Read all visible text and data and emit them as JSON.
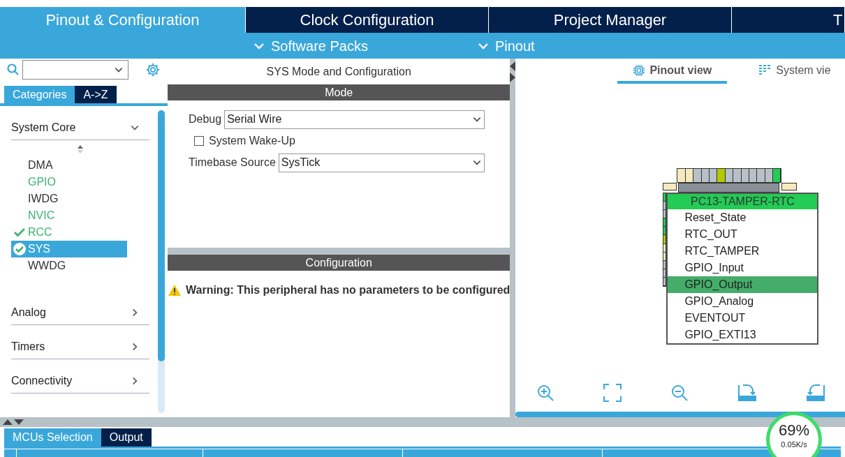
{
  "main_tabs": [
    {
      "label": "Pinout & Configuration",
      "selected": true
    },
    {
      "label": "Clock Configuration",
      "selected": false
    },
    {
      "label": "Project Manager",
      "selected": false
    },
    {
      "label": "T",
      "selected": false
    }
  ],
  "sub_menu": [
    "Software Packs",
    "Pinout"
  ],
  "sidebar": {
    "tabs": [
      {
        "label": "Categories",
        "selected": true
      },
      {
        "label": "A->Z",
        "selected": false
      }
    ],
    "categories": [
      {
        "name": "System Core",
        "expanded": true,
        "children": [
          {
            "name": "DMA",
            "enabled": false,
            "configured": false,
            "selected": false
          },
          {
            "name": "GPIO",
            "enabled": true,
            "configured": false,
            "selected": false
          },
          {
            "name": "IWDG",
            "enabled": false,
            "configured": false,
            "selected": false
          },
          {
            "name": "NVIC",
            "enabled": true,
            "configured": false,
            "selected": false
          },
          {
            "name": "RCC",
            "enabled": true,
            "configured": true,
            "selected": false
          },
          {
            "name": "SYS",
            "enabled": true,
            "configured": true,
            "selected": true
          },
          {
            "name": "WWDG",
            "enabled": false,
            "configured": false,
            "selected": false
          }
        ]
      },
      {
        "name": "Analog",
        "expanded": false
      },
      {
        "name": "Timers",
        "expanded": false
      },
      {
        "name": "Connectivity",
        "expanded": false
      }
    ]
  },
  "config_panel": {
    "title": "SYS Mode and Configuration",
    "mode_header": "Mode",
    "fields": [
      {
        "kind": "select",
        "label": "Debug",
        "value": "Serial Wire"
      },
      {
        "kind": "checkbox",
        "label": "System Wake-Up",
        "checked": false
      },
      {
        "kind": "select",
        "label": "Timebase Source",
        "value": "SysTick"
      }
    ],
    "configuration_header": "Configuration",
    "warning": "**Warning:** **This peripheral has no parameters to be configured**"
  },
  "view_tabs": [
    {
      "label": "Pinout view",
      "selected": true
    },
    {
      "label": "System vie",
      "selected": false
    }
  ],
  "pin_menu": {
    "title": "PC13-TAMPER-RTC",
    "options": [
      {
        "label": "Reset_State",
        "selected": false
      },
      {
        "label": "RTC_OUT",
        "selected": false
      },
      {
        "label": "RTC_TAMPER",
        "selected": false
      },
      {
        "label": "GPIO_Input",
        "selected": false
      },
      {
        "label": "GPIO_Output",
        "selected": true
      },
      {
        "label": "GPIO_Analog",
        "selected": false
      },
      {
        "label": "EVENTOUT",
        "selected": false
      },
      {
        "label": "GPIO_EXTI13",
        "selected": false
      }
    ]
  },
  "bottom_tabs": [
    {
      "label": "MCUs Selection",
      "selected": true
    },
    {
      "label": "Output",
      "selected": false
    }
  ],
  "speed_widget": {
    "percent": "69%",
    "rate": "0.05K/s"
  }
}
